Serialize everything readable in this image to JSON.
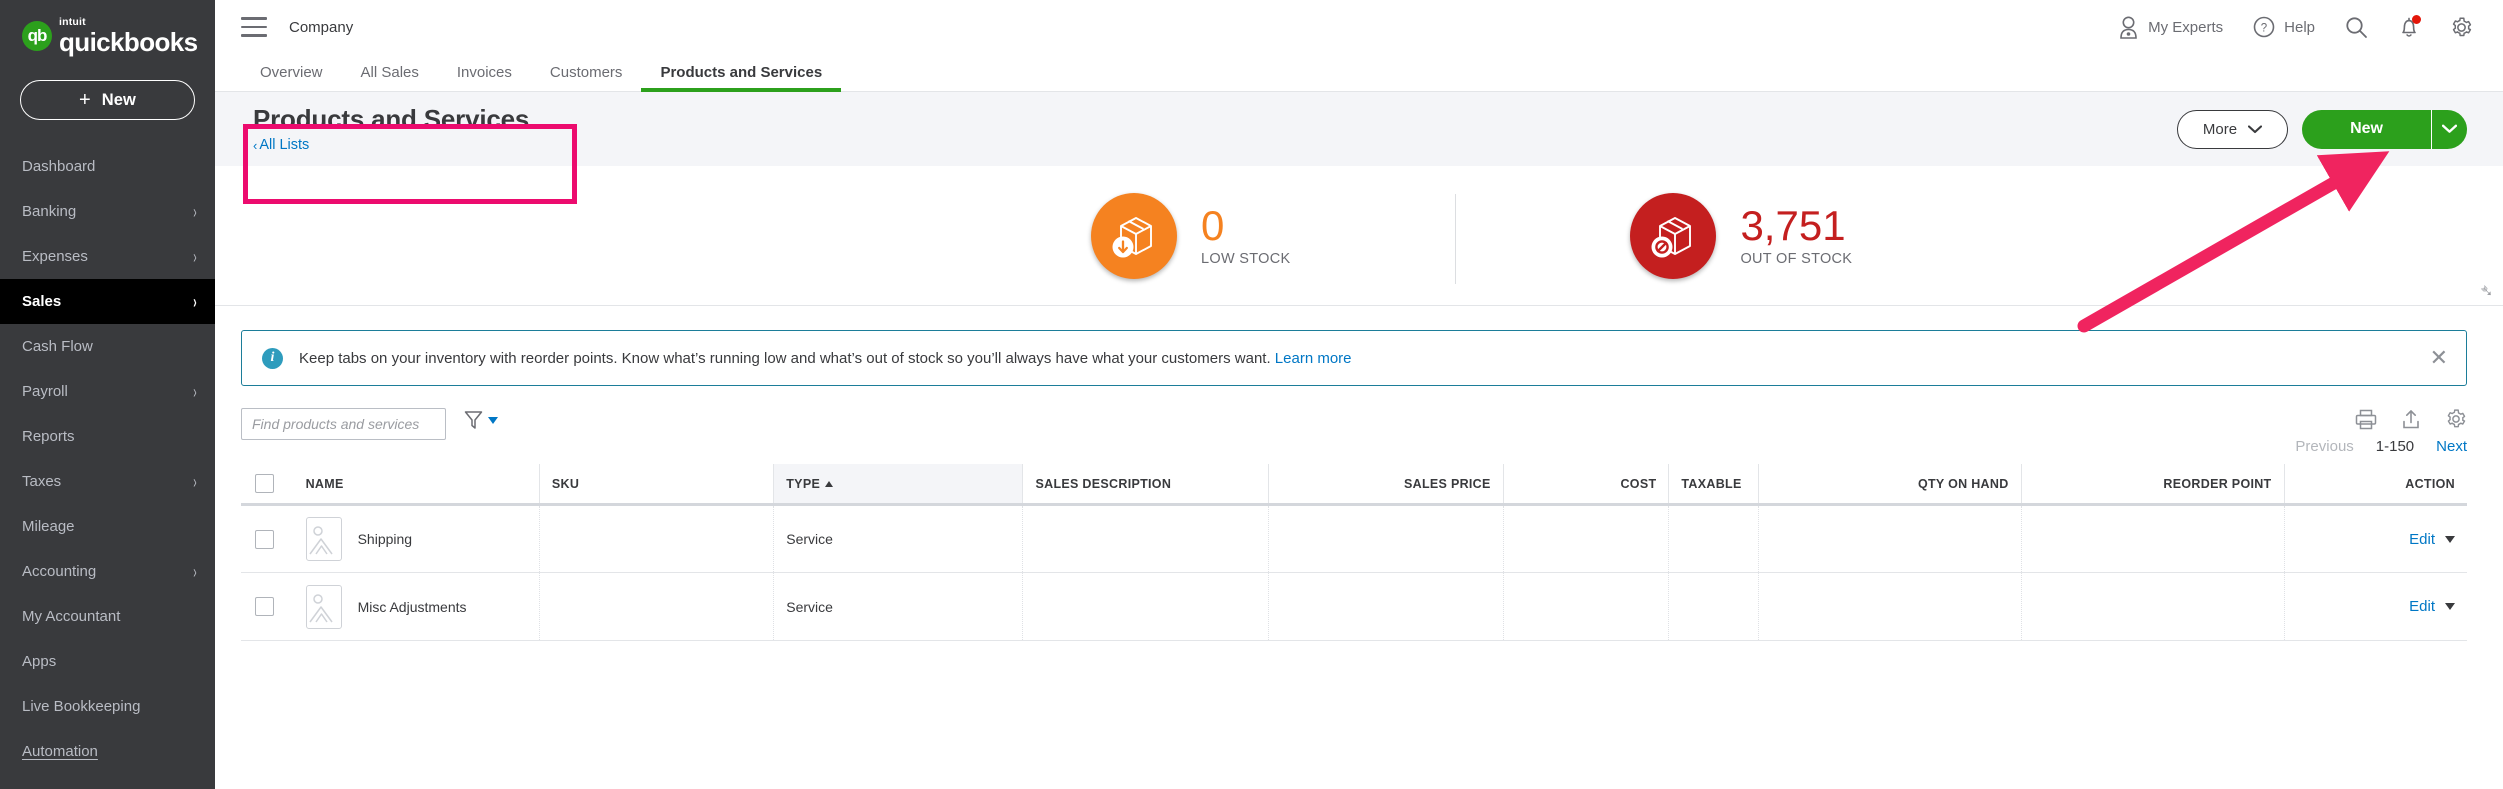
{
  "sidebar": {
    "brand": {
      "intuit": "intuit",
      "name": "quickbooks",
      "logo_icon": "qb-logo-icon"
    },
    "new_button": {
      "label": "New",
      "plus": "+"
    },
    "items": [
      {
        "label": "Dashboard",
        "chevron": "",
        "active": false
      },
      {
        "label": "Banking",
        "chevron": "›",
        "active": false
      },
      {
        "label": "Expenses",
        "chevron": "›",
        "active": false
      },
      {
        "label": "Sales",
        "chevron": "›",
        "active": true
      },
      {
        "label": "Cash Flow",
        "chevron": "",
        "active": false
      },
      {
        "label": "Payroll",
        "chevron": "›",
        "active": false
      },
      {
        "label": "Reports",
        "chevron": "",
        "active": false
      },
      {
        "label": "Taxes",
        "chevron": "›",
        "active": false
      },
      {
        "label": "Mileage",
        "chevron": "",
        "active": false
      },
      {
        "label": "Accounting",
        "chevron": "›",
        "active": false
      },
      {
        "label": "My Accountant",
        "chevron": "",
        "active": false
      },
      {
        "label": "Apps",
        "chevron": "",
        "active": false
      },
      {
        "label": "Live Bookkeeping",
        "chevron": "",
        "active": false
      },
      {
        "label": "Automation",
        "chevron": "",
        "active": false
      }
    ]
  },
  "topbar": {
    "menu_icon": "hamburger-icon",
    "company": "Company",
    "my_experts": "My Experts",
    "help": "Help",
    "search_icon": "search-icon",
    "notifications_icon": "bell-icon",
    "settings_icon": "gear-icon"
  },
  "tabs": [
    {
      "label": "Overview",
      "active": false
    },
    {
      "label": "All Sales",
      "active": false
    },
    {
      "label": "Invoices",
      "active": false
    },
    {
      "label": "Customers",
      "active": false
    },
    {
      "label": "Products and Services",
      "active": true
    }
  ],
  "page": {
    "title": "Products and Services",
    "breadcrumb": "All Lists",
    "breadcrumb_caret": "‹",
    "more_label": "More",
    "new_label": "New"
  },
  "stats": [
    {
      "value": "0",
      "label": "LOW STOCK",
      "icon": "box-arrow-down-icon",
      "color": "#f58220"
    },
    {
      "value": "3,751",
      "label": "OUT OF STOCK",
      "icon": "box-no-entry-icon",
      "color": "#c41f1f"
    }
  ],
  "banner": {
    "icon": "info-icon",
    "text": "Keep tabs on your inventory with reorder points. Know what’s running low and what’s out of stock so you’ll always have what your customers want.",
    "link": "Learn more",
    "close_icon": "close-icon"
  },
  "toolbar": {
    "search_placeholder": "Find products and services",
    "search_value": "",
    "filter_icon": "filter-funnel-icon",
    "print_icon": "print-icon",
    "export_icon": "export-upload-icon",
    "settings_icon": "gear-icon",
    "pager": {
      "previous": "Previous",
      "range": "1-150",
      "next": "Next"
    }
  },
  "table": {
    "columns": [
      {
        "label": "NAME",
        "align": "left",
        "sorted": false
      },
      {
        "label": "SKU",
        "align": "left",
        "sorted": false
      },
      {
        "label": "TYPE",
        "align": "left",
        "sorted": true
      },
      {
        "label": "SALES DESCRIPTION",
        "align": "left",
        "sorted": false
      },
      {
        "label": "SALES PRICE",
        "align": "right",
        "sorted": false
      },
      {
        "label": "COST",
        "align": "right",
        "sorted": false
      },
      {
        "label": "TAXABLE",
        "align": "left",
        "sorted": false
      },
      {
        "label": "QTY ON HAND",
        "align": "right",
        "sorted": false
      },
      {
        "label": "REORDER POINT",
        "align": "right",
        "sorted": false
      },
      {
        "label": "ACTION",
        "align": "right",
        "sorted": false
      }
    ],
    "rows": [
      {
        "name": "Shipping",
        "sku": "",
        "type": "Service",
        "sales_description": "",
        "sales_price": "",
        "cost": "",
        "taxable": "",
        "qty_on_hand": "",
        "reorder_point": "",
        "action": "Edit"
      },
      {
        "name": "Misc Adjustments",
        "sku": "",
        "type": "Service",
        "sales_description": "",
        "sales_price": "",
        "cost": "",
        "taxable": "",
        "qty_on_hand": "",
        "reorder_point": "",
        "action": "Edit"
      }
    ]
  },
  "annotations": {
    "highlight_color": "#ec0b6e",
    "arrow_color": "#f0245f",
    "arrow_target": "New"
  }
}
